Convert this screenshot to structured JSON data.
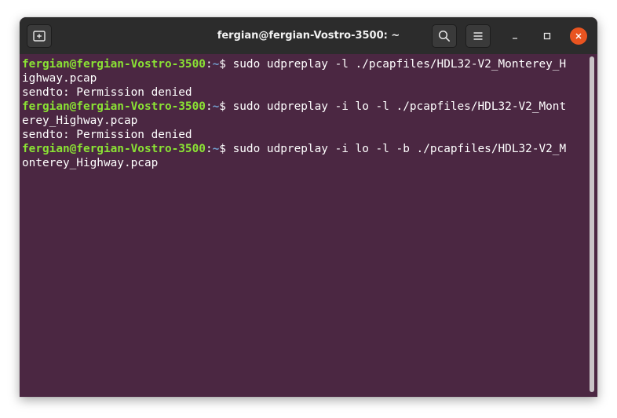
{
  "window": {
    "title": "fergian@fergian-Vostro-3500: ~"
  },
  "terminal": {
    "lines": [
      {
        "kind": "prompt",
        "user": "fergian@fergian-Vostro-3500",
        "sep": ":",
        "path": "~",
        "dollar": "$ ",
        "cmd": "sudo udpreplay -l ./pcapfiles/HDL32-V2_Monterey_H"
      },
      {
        "kind": "text",
        "text": "ighway.pcap"
      },
      {
        "kind": "text",
        "text": "sendto: Permission denied"
      },
      {
        "kind": "prompt",
        "user": "fergian@fergian-Vostro-3500",
        "sep": ":",
        "path": "~",
        "dollar": "$ ",
        "cmd": "sudo udpreplay -i lo -l ./pcapfiles/HDL32-V2_Mont"
      },
      {
        "kind": "text",
        "text": "erey_Highway.pcap"
      },
      {
        "kind": "text",
        "text": "sendto: Permission denied"
      },
      {
        "kind": "prompt",
        "user": "fergian@fergian-Vostro-3500",
        "sep": ":",
        "path": "~",
        "dollar": "$ ",
        "cmd": "sudo udpreplay -i lo -l -b ./pcapfiles/HDL32-V2_M"
      },
      {
        "kind": "text",
        "text": "onterey_Highway.pcap"
      }
    ]
  },
  "colors": {
    "background": "#4b2742",
    "titlebar": "#2c2c2c",
    "prompt_user": "#8ae234",
    "prompt_path": "#729fcf",
    "close_button": "#e95420"
  },
  "icons": {
    "new_tab": "new-tab-icon",
    "search": "search-icon",
    "menu": "hamburger-menu-icon",
    "minimize": "minimize-icon",
    "maximize": "maximize-icon",
    "close": "close-icon"
  }
}
